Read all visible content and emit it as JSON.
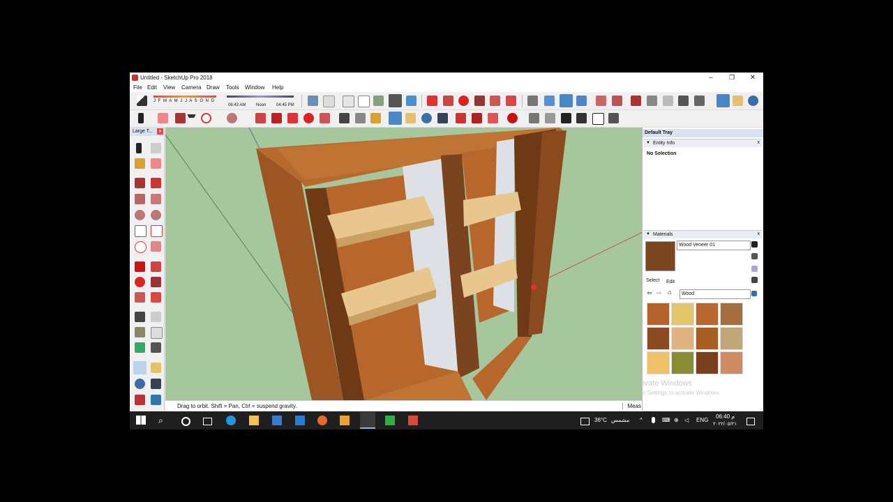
{
  "window": {
    "title": "Untitled - SketchUp Pro 2018",
    "controls": {
      "minimize": "–",
      "restore": "❐",
      "close": "✕"
    }
  },
  "menu": [
    "File",
    "Edit",
    "View",
    "Camera",
    "Draw",
    "Tools",
    "Window",
    "Help"
  ],
  "shadow_timeline": {
    "months": "J F M A M J J A S O N D",
    "time_start": "06:43 AM",
    "time_mid": "Noon",
    "time_end": "04:45 PM"
  },
  "left_panel": {
    "title": "Large T...",
    "close": "x"
  },
  "status_bar": {
    "message": "Drag to orbit. Shift = Pan, Ctrl = suspend gravity.",
    "measurements_label": "Meas"
  },
  "tray": {
    "title": "Default Tray",
    "entity_info": {
      "label": "Entity Info",
      "value": "No Selection"
    },
    "materials": {
      "label": "Materials",
      "current_material": "Wood Veneer 01",
      "tabs": {
        "select": "Select",
        "edit": "Edit"
      },
      "library": "Wood",
      "swatch_colors": [
        "#b5622b",
        "#e3c66a",
        "#b8672e",
        "#a66d3e",
        "#8a4a22",
        "#e0b37f",
        "#a65e23",
        "#c0a777",
        "#f0c16b",
        "#8a8c33",
        "#7a4020",
        "#cf8c63"
      ]
    },
    "watermark": {
      "line1": "ivate Windows",
      "line2": "o Settings to activate Windows."
    }
  },
  "taskbar": {
    "temperature": "36°C",
    "weather_label": "مشمس",
    "language": "ENG",
    "time": "06:40 م",
    "date": "٢٠٢٢/٠٥/٢١"
  },
  "colors": {
    "viewport_bg": "#a6c79b",
    "wood_dark": "#8a4520",
    "wood_light": "#b9642a",
    "shelf": "#e8c78f",
    "taskbar": "#1f1f1f"
  }
}
